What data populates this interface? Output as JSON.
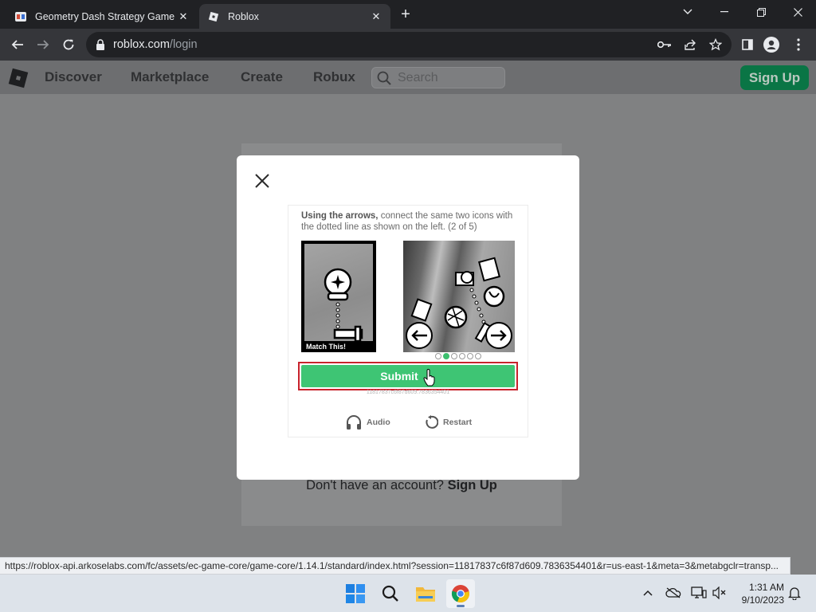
{
  "browser": {
    "tabs": [
      {
        "title": "Geometry Dash Strategy Game -",
        "active": false,
        "favicon": "geometry-dash-favicon"
      },
      {
        "title": "Roblox",
        "active": true,
        "favicon": "roblox-favicon"
      }
    ],
    "new_tab_label": "+",
    "url_host": "roblox.com",
    "url_path": "/login"
  },
  "roblox_header": {
    "nav": [
      "Discover",
      "Marketplace",
      "Create",
      "Robux"
    ],
    "search_placeholder": "Search",
    "signup_label": "Sign Up",
    "signup_color": "#0a7545"
  },
  "login_page": {
    "no_account_text": "Don't have an account?",
    "sign_up_link": "Sign Up"
  },
  "captcha": {
    "instruction_bold": "Using the arrows,",
    "instruction_rest": " connect the same two icons with the dotted line as shown on the left. (2 of 5)",
    "match_label": "Match This!",
    "progress": {
      "current": 2,
      "total": 6
    },
    "submit_label": "Submit",
    "submit_color": "#3ec574",
    "session_text": "11817837c6f87d609.7836354401",
    "audio_label": "Audio",
    "restart_label": "Restart"
  },
  "status_url": "https://roblox-api.arkoselabs.com/fc/assets/ec-game-core/game-core/1.14.1/standard/index.html?session=11817837c6f87d609.7836354401&r=us-east-1&meta=3&metabgclr=transp...",
  "taskbar": {
    "time": "1:31 AM",
    "date": "9/10/2023"
  }
}
